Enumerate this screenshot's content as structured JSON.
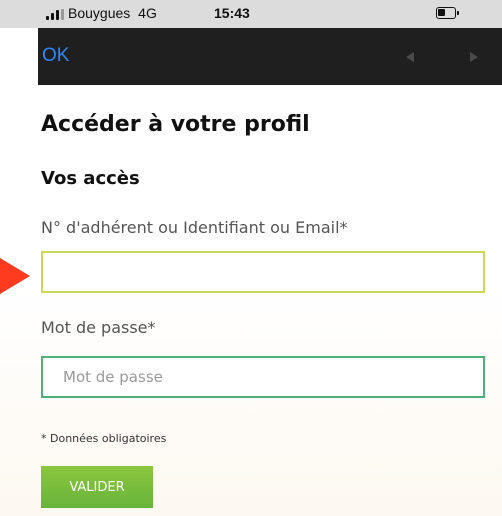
{
  "status_bar": {
    "carrier": "Bouygues",
    "network": "4G",
    "time": "15:43",
    "battery_level": 0.4
  },
  "toolbar": {
    "ok_label": "OK",
    "back_icon": "triangle-left-icon",
    "forward_icon": "triangle-right-icon"
  },
  "form": {
    "title": "Accéder à votre profil",
    "section_title": "Vos accès",
    "id_label": "N° d'adhérent ou Identifiant ou Email*",
    "id_value": "",
    "id_placeholder": "",
    "password_label": "Mot de passe*",
    "password_value": "",
    "password_placeholder": "Mot de passe",
    "required_note": "* Données obligatoires",
    "submit_label": "VALIDER"
  },
  "colors": {
    "accent": "#2e87f5",
    "button_green": "#7bbd3c",
    "id_border": "#cfd45a",
    "password_border": "#4fb07c",
    "annotation": "#ff3b1f"
  }
}
